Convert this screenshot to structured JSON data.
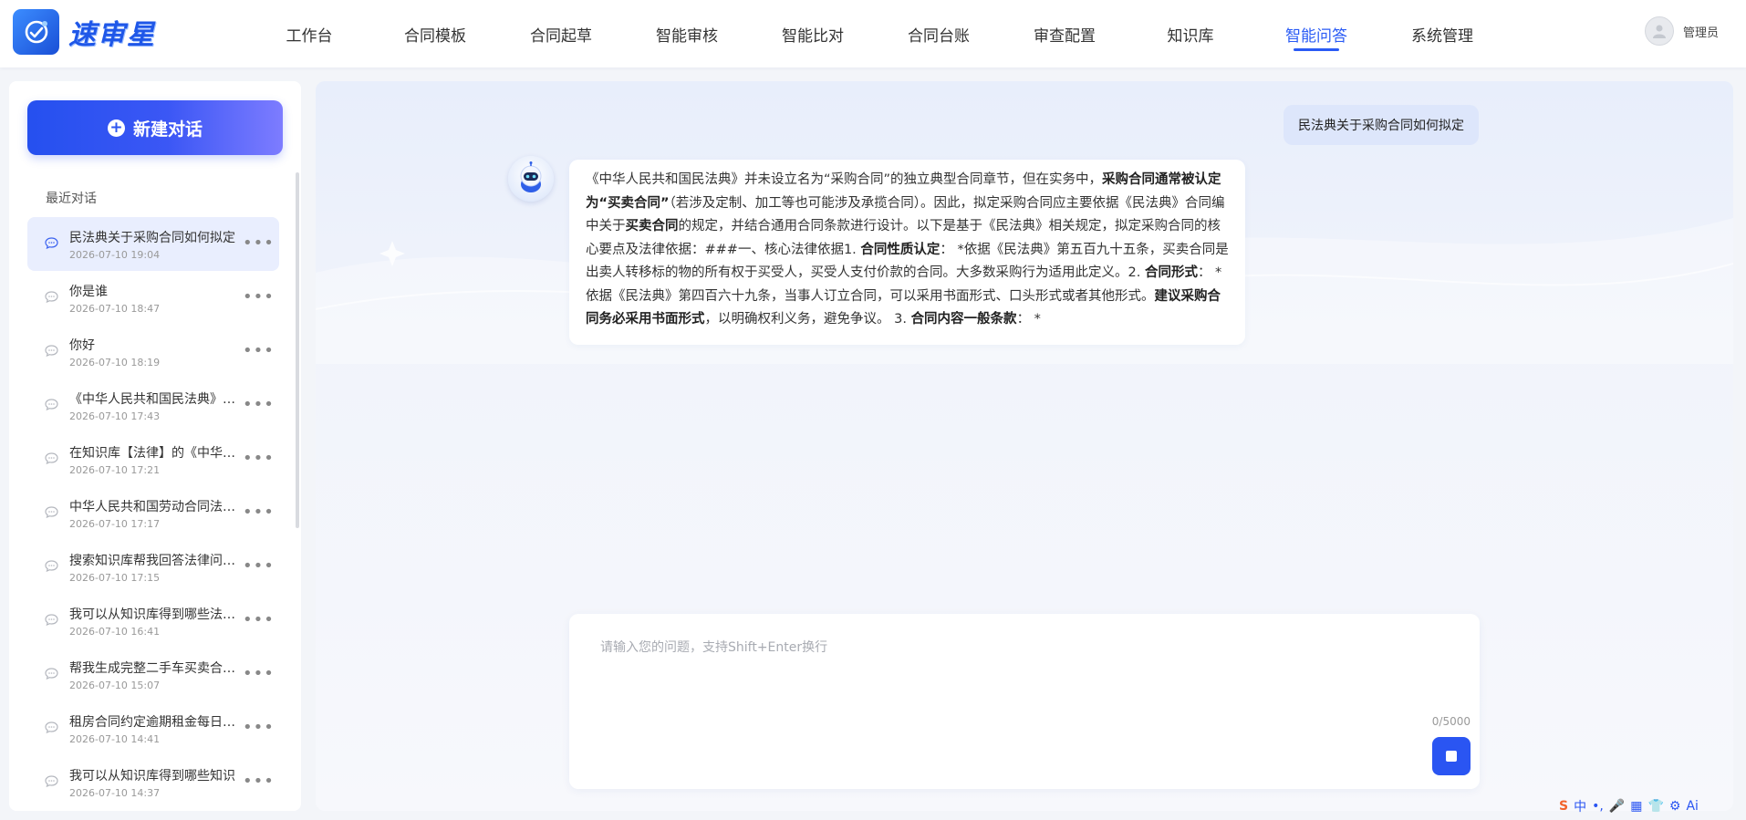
{
  "app": {
    "logo_text": "速审星",
    "brand_color": "#2a5bf5"
  },
  "nav": {
    "items": [
      {
        "label": "工作台"
      },
      {
        "label": "合同模板"
      },
      {
        "label": "合同起草"
      },
      {
        "label": "智能审核"
      },
      {
        "label": "智能比对"
      },
      {
        "label": "合同台账"
      },
      {
        "label": "审查配置"
      },
      {
        "label": "知识库"
      },
      {
        "label": "智能问答",
        "active": true
      },
      {
        "label": "系统管理"
      }
    ]
  },
  "user": {
    "name": "管理员",
    "avatar_icon": "avatar-icon"
  },
  "sidebar": {
    "new_chat_label": "新建对话",
    "recent_title": "最近对话",
    "conversations": [
      {
        "title": "民法典关于采购合同如何拟定",
        "time": "2026-07-10 19:04",
        "active": true
      },
      {
        "title": "你是谁",
        "time": "2026-07-10 18:47"
      },
      {
        "title": "你好",
        "time": "2026-07-10 18:19"
      },
      {
        "title": "《中华人民共和国民法典》…",
        "time": "2026-07-10 17:43"
      },
      {
        "title": "在知识库【法律】的《中华…",
        "time": "2026-07-10 17:21"
      },
      {
        "title": "中华人民共和国劳动合同法…",
        "time": "2026-07-10 17:17"
      },
      {
        "title": "搜索知识库帮我回答法律问…",
        "time": "2026-07-10 17:15"
      },
      {
        "title": "我可以从知识库得到哪些法…",
        "time": "2026-07-10 16:41"
      },
      {
        "title": "帮我生成完整二手车买卖合…",
        "time": "2026-07-10 15:07"
      },
      {
        "title": "租房合同约定逾期租金每日 …",
        "time": "2026-07-10 14:41"
      },
      {
        "title": "我可以从知识库得到哪些知识",
        "time": "2026-07-10 14:37"
      }
    ]
  },
  "chat": {
    "user_message": "民法典关于采购合同如何拟定",
    "bot_message": {
      "p1": "《中华人民共和国民法典》并未设立名为“采购合同”的独立典型合同章节，但在实务中，",
      "b1": "采购合同通常被认定为“买卖合同”",
      "p2": "（若涉及定制、加工等也可能涉及承揽合同）。因此，拟定采购合同应主要依据《民法典》合同编中关于",
      "b2": "买卖合同",
      "p3": "的规定，并结合通用合同条款进行设计。以下是基于《民法典》相关规定，拟定采购合同的核心要点及法律依据：###一、核心法律依据1. ",
      "b3": "合同性质认定",
      "p4": "：  *依据《民法典》第五百九十五条，买卖合同是出卖人转移标的物的所有权于买受人，买受人支付价款的合同。大多数采购行为适用此定义。2. ",
      "b4": "合同形式",
      "p5": "：  * 依据《民法典》第四百六十九条，当事人订立合同，可以采用书面形式、口头形式或者其他形式。",
      "b5": "建议采购合同务必采用书面形式",
      "p6": "，以明确权利义务，避免争议。 3. ",
      "b6": "合同内容一般条款",
      "p7": "：  *"
    },
    "input_placeholder": "请输入您的问题，支持Shift+Enter换行",
    "input_value": "",
    "counter": "0/5000"
  },
  "ime": {
    "items": [
      "S",
      "中",
      "•,",
      "🎤",
      "▦",
      "👕",
      "⚙",
      "Ai"
    ]
  }
}
